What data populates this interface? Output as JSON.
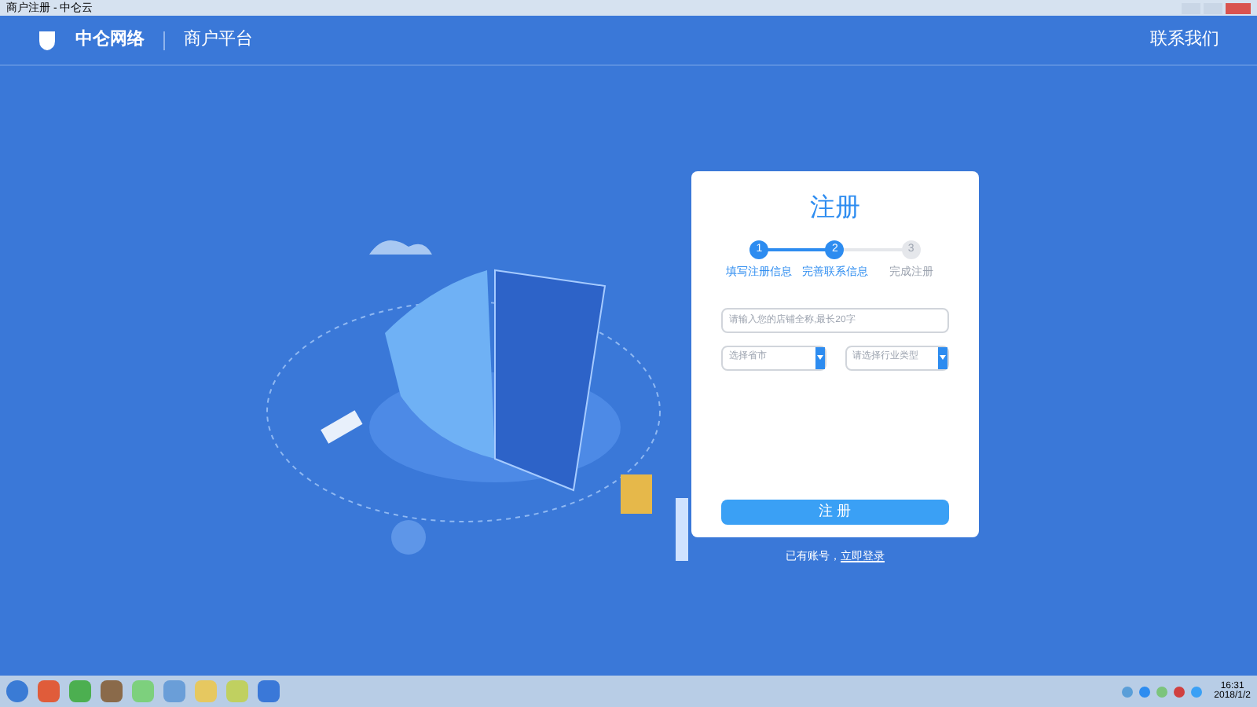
{
  "window": {
    "title": "商户注册 - 中仑云"
  },
  "header": {
    "logo_text": "中仑网络",
    "platform": "商户平台",
    "contact_link": "联系我们"
  },
  "form": {
    "title": "注册",
    "steps": [
      {
        "number": "1",
        "label": "填写注册信息",
        "active": true
      },
      {
        "number": "2",
        "label": "完善联系信息",
        "active": true
      },
      {
        "number": "3",
        "label": "完成注册",
        "active": false
      }
    ],
    "name_field": {
      "placeholder": "请输入您的店铺全称,最长20字"
    },
    "selects": [
      {
        "placeholder": "选择省市"
      },
      {
        "placeholder": "请选择行业类型"
      }
    ],
    "submit": "注 册"
  },
  "login_prompt": {
    "text": "已有账号，",
    "link": "立即登录"
  },
  "taskbar": {
    "time": "16:31",
    "date": "2018/1/2"
  }
}
